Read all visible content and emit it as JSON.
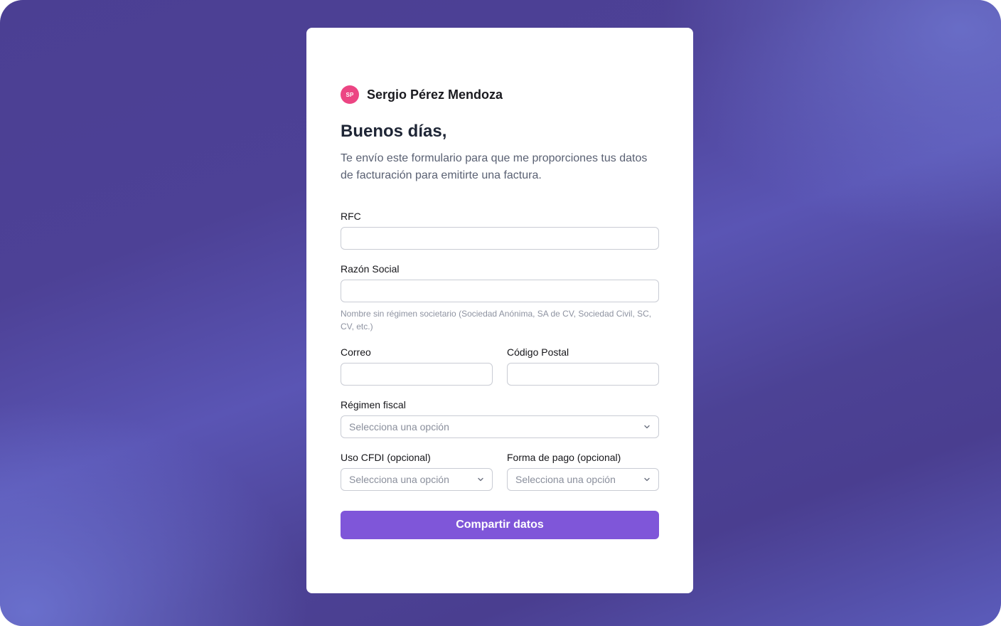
{
  "sender": {
    "initials": "SP",
    "name": "Sergio Pérez Mendoza",
    "avatar_color": "#ec4583"
  },
  "greeting": "Buenos días,",
  "intro": "Te envío este formulario para que me proporciones tus datos de facturación para emitirte una factura.",
  "form": {
    "rfc": {
      "label": "RFC",
      "value": ""
    },
    "razon_social": {
      "label": "Razón Social",
      "value": "",
      "hint": "Nombre sin régimen societario (Sociedad Anónima, SA de CV, Sociedad Civil, SC, CV, etc.)"
    },
    "correo": {
      "label": "Correo",
      "value": ""
    },
    "codigo_postal": {
      "label": "Código Postal",
      "value": ""
    },
    "regimen_fiscal": {
      "label": "Régimen fiscal",
      "selected": "Selecciona una opción",
      "icon": "chevron-down-icon"
    },
    "uso_cfdi": {
      "label": "Uso CFDI (opcional)",
      "selected": "Selecciona una opción",
      "icon": "chevron-down-icon"
    },
    "forma_pago": {
      "label": "Forma de pago (opcional)",
      "selected": "Selecciona una opción",
      "icon": "chevron-down-icon"
    },
    "submit_label": "Compartir datos"
  },
  "colors": {
    "accent": "#7f56d9",
    "background_gradient": [
      "#4b3f93",
      "#6b70cf"
    ]
  }
}
